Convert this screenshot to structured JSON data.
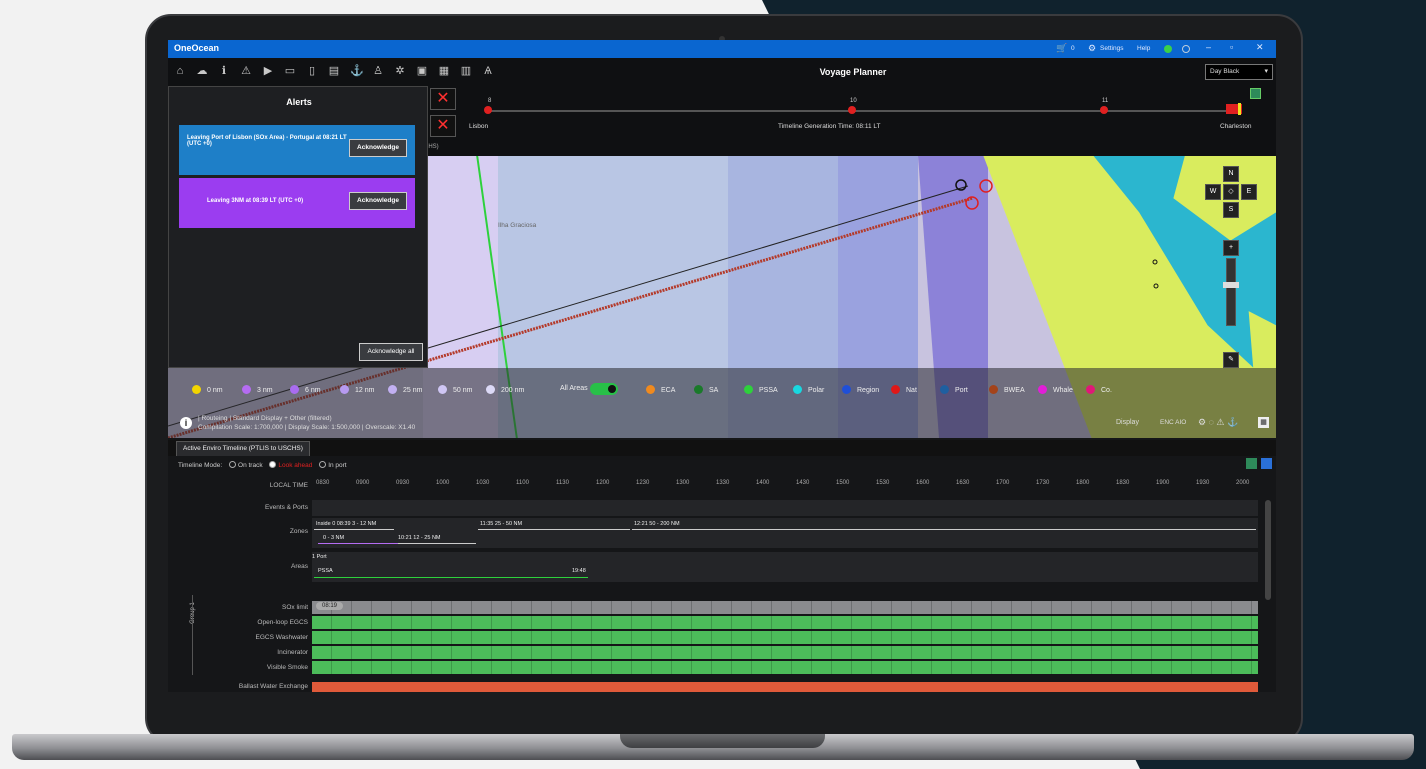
{
  "app": {
    "title": "OneOcean",
    "cart_count": "0",
    "settings_label": "Settings",
    "help_label": "Help",
    "window_controls": [
      "–",
      "▫",
      "✕"
    ]
  },
  "toolbar": {
    "icons": [
      "home-icon",
      "cloud-icon",
      "info-icon",
      "warning-icon",
      "play-icon",
      "map-icon",
      "book-icon",
      "catalog-icon",
      "anchor-icon",
      "person-icon",
      "gear-icon",
      "layers-icon",
      "grid-icon",
      "list-icon",
      "compass-icon"
    ],
    "title": "Voyage Planner",
    "theme_value": "Day Black"
  },
  "route": {
    "start_port": "Lisbon",
    "end_port": "Charleston",
    "markers": [
      "8",
      "10",
      "11"
    ],
    "timeline_generation": "Timeline Generation Time: 08:11 LT"
  },
  "alerts": {
    "title": "Alerts",
    "items": [
      {
        "text": "Leaving Port of Lisbon (SOx Area) - Portugal at 08:21 LT (UTC +0)",
        "button": "Acknowledge",
        "color": "#1e7fc8"
      },
      {
        "text": "Leaving 3NM at 08:39 LT (UTC +0)",
        "button": "Acknowledge",
        "color": "#9b3df0"
      }
    ],
    "ack_all": "Acknowledge all"
  },
  "map": {
    "place_label": "Ilha Graciosa",
    "compass": {
      "n": "N",
      "s": "S",
      "e": "E",
      "w": "W"
    },
    "zoom_in": "+",
    "zoom_out": "–"
  },
  "legend": {
    "distances": [
      {
        "label": "0 nm",
        "color": "#f2d500"
      },
      {
        "label": "3 nm",
        "color": "#b56cf2"
      },
      {
        "label": "6 nm",
        "color": "#a96cf0"
      },
      {
        "label": "12 nm",
        "color": "#b79af0"
      },
      {
        "label": "25 nm",
        "color": "#c2b0f2"
      },
      {
        "label": "50 nm",
        "color": "#cfc6f4"
      },
      {
        "label": "200 nm",
        "color": "#dcd9f6"
      }
    ],
    "all_areas_label": "All Areas",
    "areas": [
      {
        "label": "ECA",
        "color": "#f08a1e"
      },
      {
        "label": "SA",
        "color": "#1a7a2a"
      },
      {
        "label": "PSSA",
        "color": "#2ed13c"
      },
      {
        "label": "Polar",
        "color": "#18d8e0"
      },
      {
        "label": "Region",
        "color": "#1f4fd8"
      },
      {
        "label": "Nat",
        "color": "#e01818"
      },
      {
        "label": "Port",
        "color": "#1f5fa0"
      },
      {
        "label": "BWEA",
        "color": "#a4431a"
      },
      {
        "label": "Whale",
        "color": "#e21ed8"
      },
      {
        "label": "Co.",
        "color": "#e01878"
      }
    ],
    "scale_line1": "| Routeing | Standard Display + Other (filtered)",
    "scale_line2": "Compilation Scale: 1:700,000 | Display Scale: 1:500,000 | Overscale: X1.40",
    "display_label": "Display",
    "chart_modes": "ENC AIO"
  },
  "timeline": {
    "tab_label": "Active Enviro Timeline (PTLIS to USCHS)",
    "mode_label": "Timeline Mode:",
    "modes": [
      "On track",
      "Look ahead",
      "In port"
    ],
    "local_time_label": "LOCAL TIME",
    "times": [
      "0830",
      "0900",
      "0930",
      "1000",
      "1030",
      "1100",
      "1130",
      "1200",
      "1230",
      "1300",
      "1330",
      "1400",
      "1430",
      "1500",
      "1530",
      "1600",
      "1630",
      "1700",
      "1730",
      "1800",
      "1830",
      "1900",
      "1930",
      "2000"
    ],
    "rows": {
      "events_ports": "Events & Ports",
      "zones": "Zones",
      "areas": "Areas",
      "sox_limit": "SOx limit",
      "open_loop": "Open-loop EGCS",
      "egcs_washwater": "EGCS Washwater",
      "incinerator": "Incinerator",
      "visible_smoke": "Visible Smoke",
      "ballast": "Ballast Water Exchange"
    },
    "group_label": "Group 1",
    "zone_segments": [
      "Inside 0  08:39  3 - 12 NM",
      "0 - 3 NM",
      "10:21  12 - 25 NM",
      "11:35  25 - 50 NM",
      "12:21  50 - 200 NM"
    ],
    "area_segments": [
      "1 Port",
      "PSSA",
      "19:48"
    ],
    "sox_time": "08:19"
  }
}
